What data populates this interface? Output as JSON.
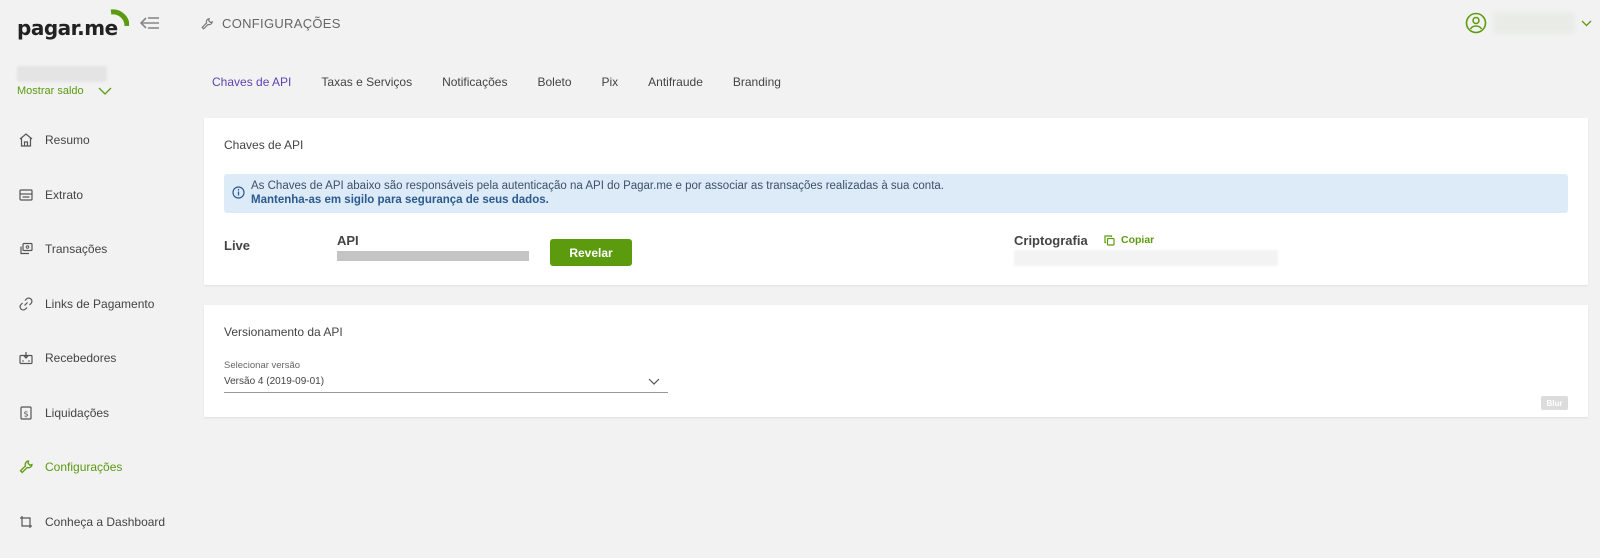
{
  "brand": {
    "logo_text": "pagar.me",
    "accent": "#5d9b0e",
    "tab_active": "#5b45b0"
  },
  "sidebar": {
    "balance_toggle": "Mostrar saldo",
    "items": [
      {
        "label": "Resumo",
        "icon": "home-icon"
      },
      {
        "label": "Extrato",
        "icon": "statement-icon"
      },
      {
        "label": "Transações",
        "icon": "transactions-icon"
      },
      {
        "label": "Links de Pagamento",
        "icon": "link-icon"
      },
      {
        "label": "Recebedores",
        "icon": "recipients-icon"
      },
      {
        "label": "Liquidações",
        "icon": "settlements-icon"
      },
      {
        "label": "Configurações",
        "icon": "wrench-icon",
        "active": true
      },
      {
        "label": "Conheça a Dashboard",
        "icon": "tour-icon"
      }
    ]
  },
  "header": {
    "title": "CONFIGURAÇÕES"
  },
  "tabs": [
    "Chaves de API",
    "Taxas e Serviços",
    "Notificações",
    "Boleto",
    "Pix",
    "Antifraude",
    "Branding"
  ],
  "api_keys": {
    "title": "Chaves de API",
    "info_text": "As Chaves de API abaixo são responsáveis pela autenticação na API do Pagar.me e por associar as transações realizadas à sua conta.",
    "info_bold": "Mantenha-as em sigilo para segurança de seus dados.",
    "env_label": "Live",
    "api_label": "API",
    "reveal_label": "Revelar",
    "crypto_label": "Criptografia",
    "copy_label": "Copiar"
  },
  "versioning": {
    "title": "Versionamento da API",
    "select_label": "Selecionar versão",
    "selected_value": "Versão 4 (2019-09-01)",
    "blur_tag": "Blur"
  }
}
